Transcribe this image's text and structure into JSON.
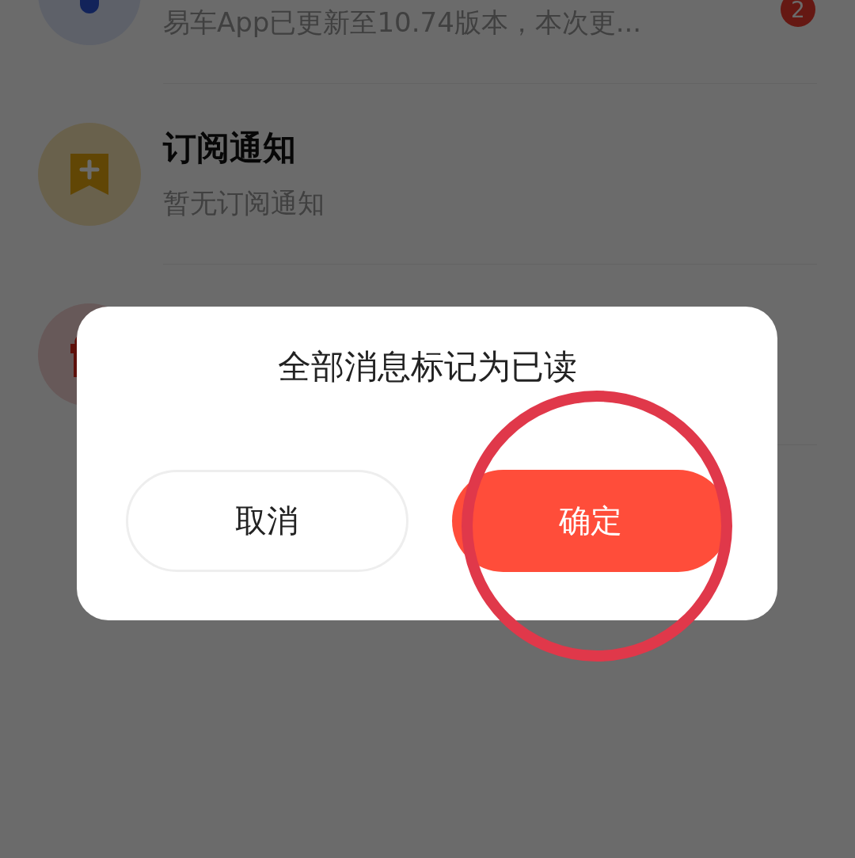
{
  "notifications": [
    {
      "kind": "update",
      "subtitle": "易车App已更新至10.74版本，本次更...",
      "badge": "2"
    },
    {
      "kind": "subscription",
      "title": "订阅通知",
      "subtitle": "暂无订阅通知"
    },
    {
      "kind": "activity"
    }
  ],
  "dialog": {
    "message": "全部消息标记为已读",
    "buttons": [
      {
        "kind": "cancel",
        "label": "取消"
      },
      {
        "kind": "confirm",
        "label": "确定"
      }
    ]
  }
}
